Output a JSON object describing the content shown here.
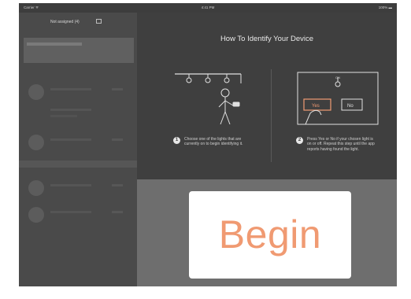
{
  "status": {
    "carrier": "Carrier ᯤ",
    "time": "4:41 PM",
    "battery": "100% ▬"
  },
  "sidebar": {
    "title": "Not assigned (4)"
  },
  "panel": {
    "title": "How To Identify Your Device",
    "steps": [
      {
        "num": "1",
        "text": "Choose one of the lights that are currently on to begin identifying it."
      },
      {
        "num": "2",
        "text": "Press Yes or No if your chosen light is on or off. Repeat this step until the app reports having found the light."
      }
    ],
    "illus_right": {
      "yes_label": "Yes",
      "no_label": "No"
    }
  },
  "begin": {
    "label": "Begin"
  },
  "colors": {
    "accent": "#f09a72",
    "background": "#3d3d3d"
  }
}
